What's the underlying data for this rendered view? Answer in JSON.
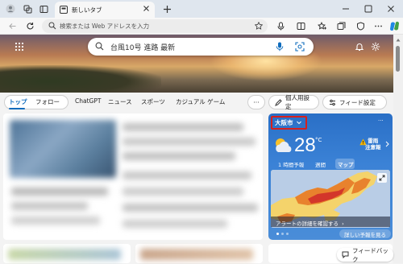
{
  "browser": {
    "tab_title": "新しいタブ",
    "address_placeholder": "検索または Web アドレスを入力"
  },
  "hero": {
    "search_text": "台風10号 進路 最新"
  },
  "nav": {
    "items": [
      "トップ",
      "フォロー",
      "ChatGPT",
      "ニュース",
      "スポーツ",
      "カジュアル ゲーム"
    ],
    "more": "···",
    "personal_settings": "個人用設定",
    "feed_settings": "フィード設定"
  },
  "weather": {
    "city": "大阪市",
    "temperature": "28",
    "unit": "°C",
    "alert_line1": "雷雨",
    "alert_line2": "注意報",
    "tabs": [
      "1 時間予報",
      "週間",
      "マップ"
    ],
    "selected_tab": "マップ",
    "map_banner": "アラートの詳細を確認する",
    "detail_button": "詳しい予報を見る",
    "more": "···"
  },
  "feedback": "フィードバック",
  "colors": {
    "accent": "#0f6cbd",
    "weather_card": "#3b82d6",
    "city_highlight": "#d6201e"
  }
}
